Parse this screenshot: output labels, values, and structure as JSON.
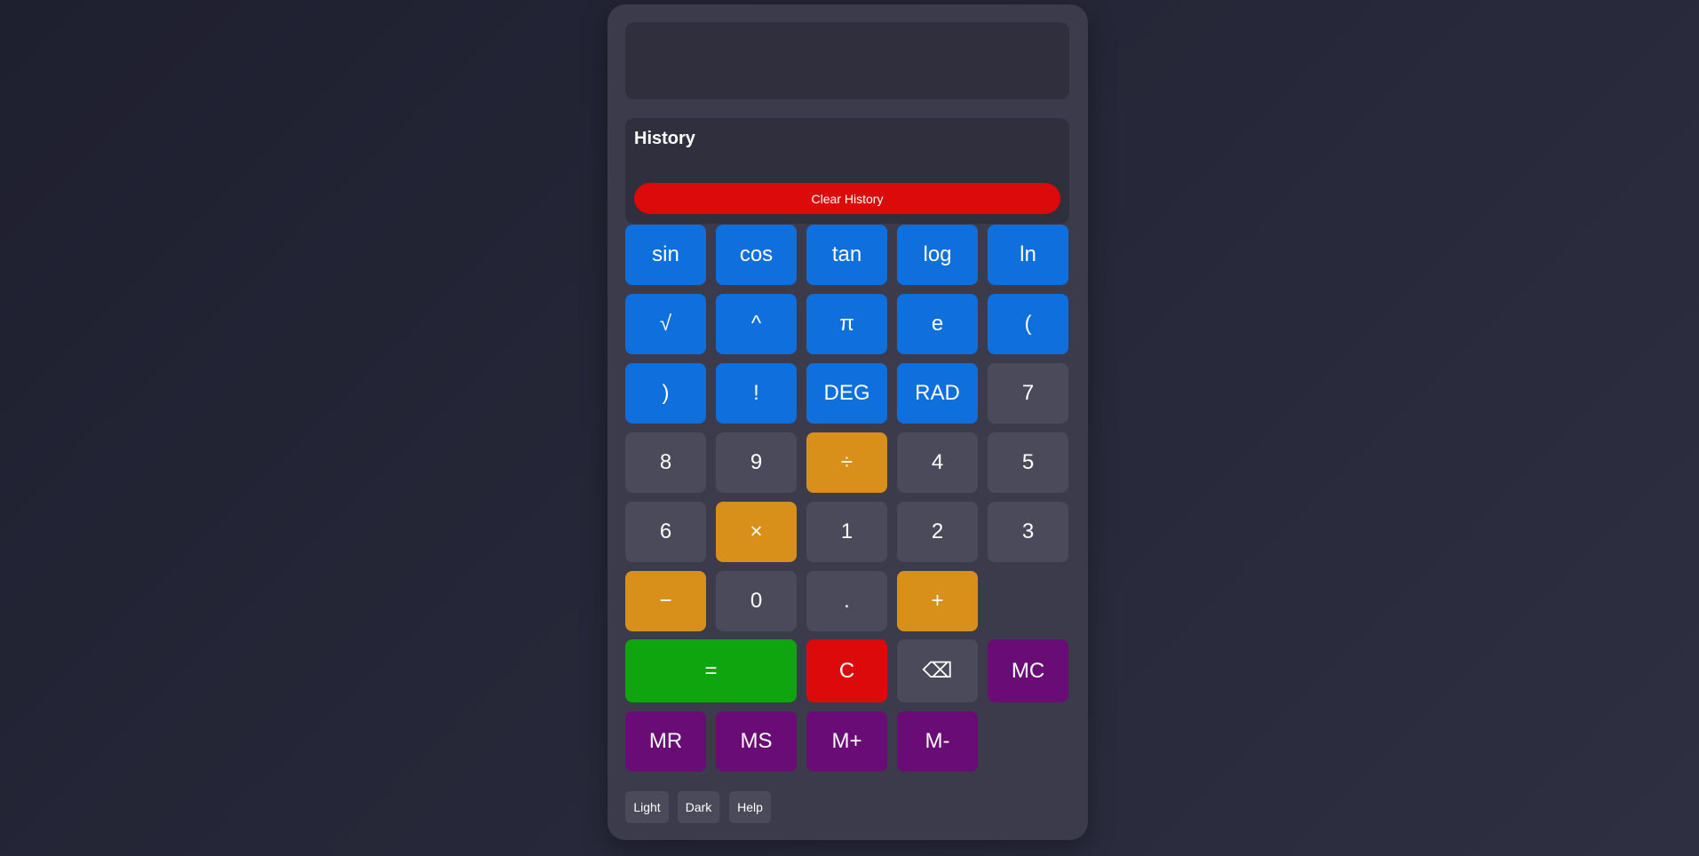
{
  "history": {
    "title": "History",
    "clear_label": "Clear History"
  },
  "keys": {
    "sin": "sin",
    "cos": "cos",
    "tan": "tan",
    "log": "log",
    "ln": "ln",
    "sqrt": "√",
    "pow": "^",
    "pi": "π",
    "e": "e",
    "lparen": "(",
    "rparen": ")",
    "fact": "!",
    "deg": "DEG",
    "rad": "RAD",
    "seven": "7",
    "eight": "8",
    "nine": "9",
    "divide": "÷",
    "four": "4",
    "five": "5",
    "six": "6",
    "multiply": "×",
    "one": "1",
    "two": "2",
    "three": "3",
    "minus": "−",
    "zero": "0",
    "dot": ".",
    "plus": "+",
    "equals": "=",
    "clear": "C",
    "backspace": "⌫",
    "mc": "MC",
    "mr": "MR",
    "ms": "MS",
    "mplus": "M+",
    "mminus": "M-"
  },
  "theme": {
    "light": "Light",
    "dark": "Dark",
    "help": "Help"
  },
  "colors": {
    "function": "#0f6fdc",
    "number": "#4a4a5a",
    "operator": "#d8901a",
    "equals": "#0ea50e",
    "clear": "#dc0a0a",
    "memory": "#6a0c75"
  }
}
